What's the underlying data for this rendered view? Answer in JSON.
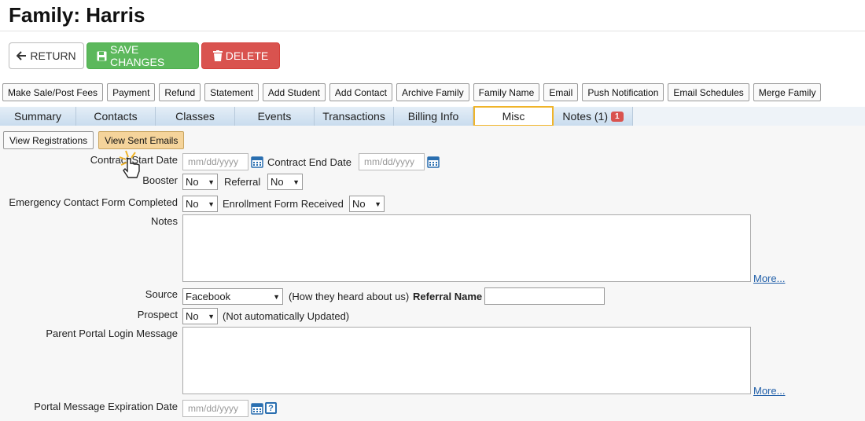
{
  "page": {
    "title": "Family: Harris"
  },
  "actions": {
    "return": "RETURN",
    "save": "SAVE CHANGES",
    "delete": "DELETE"
  },
  "toolbar": [
    "Make Sale/Post Fees",
    "Payment",
    "Refund",
    "Statement",
    "Add Student",
    "Add Contact",
    "Archive Family",
    "Family Name",
    "Email",
    "Push Notification",
    "Email Schedules",
    "Merge Family"
  ],
  "tabs": [
    "Summary",
    "Contacts",
    "Classes",
    "Events",
    "Transactions",
    "Billing Info",
    "Misc",
    "Notes (1)"
  ],
  "notes_badge": "1",
  "sub_buttons": {
    "view_registrations": "View Registrations",
    "view_sent_emails": "View Sent Emails"
  },
  "form": {
    "contract_start_label": "Contract Start Date",
    "contract_end_label": "Contract End Date",
    "date_placeholder": "mm/dd/yyyy",
    "booster_label": "Booster",
    "booster_value": "No",
    "referral_label": "Referral",
    "referral_value": "No",
    "emergency_label": "Emergency Contact Form Completed",
    "emergency_value": "No",
    "enrollment_label": "Enrollment Form Received",
    "enrollment_value": "No",
    "notes_label": "Notes",
    "more": "More...",
    "source_label": "Source",
    "source_value": "Facebook",
    "source_hint": "(How they heard about us)",
    "referral_name_label": "Referral Name",
    "prospect_label": "Prospect",
    "prospect_value": "No",
    "prospect_hint": "(Not automatically Updated)",
    "portal_msg_label": "Parent Portal Login Message",
    "portal_exp_label": "Portal Message Expiration Date",
    "help_glyph": "?"
  },
  "colors": {
    "save": "#5cb85c",
    "delete": "#d9534f",
    "active_tab_border": "#f0b429",
    "link": "#1f5ea8"
  }
}
